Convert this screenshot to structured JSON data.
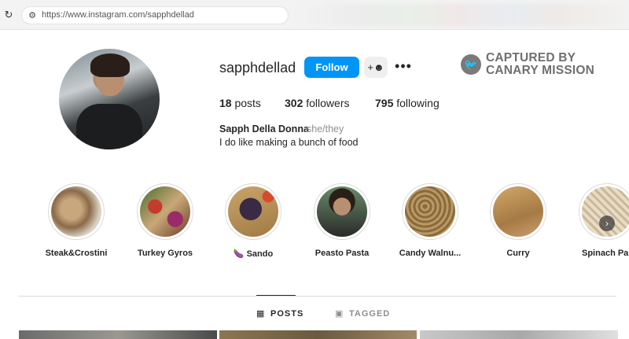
{
  "browser": {
    "url": "https://www.instagram.com/sapphdellad"
  },
  "profile": {
    "username": "sapphdellad",
    "follow_label": "Follow",
    "more_label": "•••",
    "posts_count": "18",
    "posts_label": "posts",
    "followers_count": "302",
    "followers_label": "followers",
    "following_count": "795",
    "following_label": "following",
    "full_name": "Sapph Della Donna",
    "pronouns": "she/they",
    "bio": "I do like making a bunch of food"
  },
  "watermark": {
    "line1": "CAPTURED BY",
    "line2": "CANARY MISSION"
  },
  "highlights": [
    {
      "label": "Steak&Crostini"
    },
    {
      "label": "Turkey Gyros"
    },
    {
      "label": "🍆 Sando"
    },
    {
      "label": "Peasto Pasta"
    },
    {
      "label": "Candy Walnu..."
    },
    {
      "label": "Curry"
    },
    {
      "label": "Spinach Pa"
    }
  ],
  "tabs": {
    "posts": "POSTS",
    "tagged": "TAGGED"
  },
  "icons": {
    "reload": "reload-icon",
    "site_info": "site-info-icon",
    "add_user": "add-user-icon",
    "canary": "canary-bird-icon",
    "grid": "grid-icon",
    "tagged": "tagged-icon",
    "next": "chevron-right-icon"
  },
  "colors": {
    "follow_button": "#0095f6",
    "text": "#262626",
    "muted": "#8e8e8e"
  }
}
